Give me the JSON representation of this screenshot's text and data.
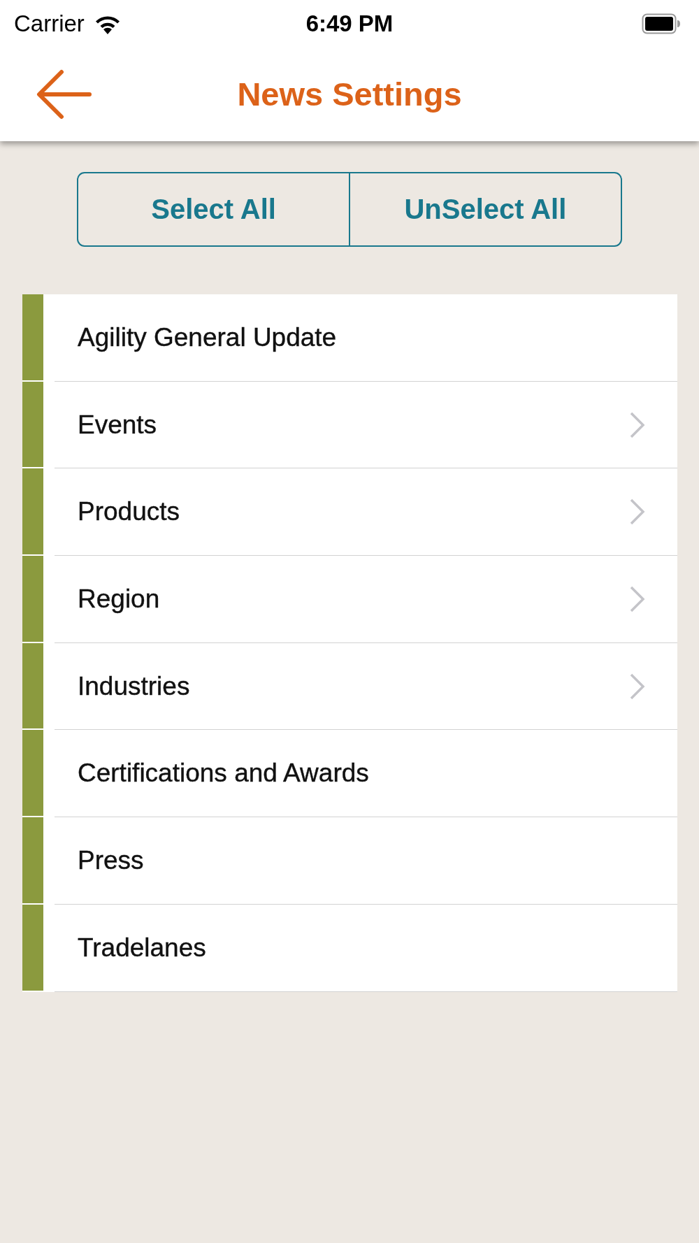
{
  "status_bar": {
    "carrier": "Carrier",
    "time": "6:49 PM"
  },
  "nav_bar": {
    "title": "News Settings"
  },
  "selection_buttons": [
    "Select All",
    "UnSelect All"
  ],
  "items": [
    {
      "label": "Agility General Update",
      "selected": true,
      "kind": "option"
    },
    {
      "label": "Events",
      "selected": true,
      "kind": "submenu"
    },
    {
      "label": "Products",
      "selected": true,
      "kind": "submenu"
    },
    {
      "label": "Region",
      "selected": true,
      "kind": "submenu"
    },
    {
      "label": "Industries",
      "selected": true,
      "kind": "submenu"
    },
    {
      "label": "Certifications and Awards",
      "selected": true,
      "kind": "option"
    },
    {
      "label": "Press",
      "selected": true,
      "kind": "option"
    },
    {
      "label": "Tradelanes",
      "selected": true,
      "kind": "option"
    }
  ]
}
